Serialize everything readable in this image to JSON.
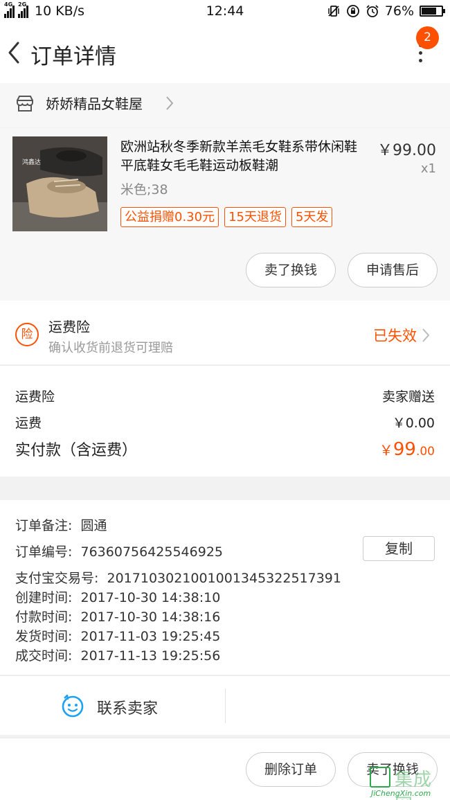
{
  "status_bar": {
    "network_4g": "4G",
    "network_2g": "2G",
    "speed": "10 KB/s",
    "time": "12:44",
    "battery_percent": "76%",
    "battery_level": 0.76
  },
  "header": {
    "title": "订单详情",
    "badge_count": "2"
  },
  "shop": {
    "name": "娇娇精品女鞋屋"
  },
  "product": {
    "title": "欧洲站秋冬季新款羊羔毛女鞋系带休闲鞋平底鞋女毛毛鞋运动板鞋潮",
    "price": "￥99.00",
    "quantity": "x1",
    "sku": "米色;38",
    "image_caption": "鸿鑫达",
    "tags": [
      "公益捐赠0.30元",
      "15天退货",
      "5天发"
    ],
    "actions": [
      "卖了换钱",
      "申请售后"
    ]
  },
  "insurance": {
    "title": "运费险",
    "icon_text": "险",
    "subtitle": "确认收货前退货可理赔",
    "status": "已失效"
  },
  "fees": {
    "insurance_label": "运费险",
    "insurance_value": "卖家赠送",
    "shipping_label": "运费",
    "shipping_value": "￥0.00",
    "total_label": "实付款（含运费）",
    "total_symbol": "￥",
    "total_int": "99",
    "total_dec": ".00"
  },
  "order_info": {
    "remark_label": "订单备注:",
    "remark_value": "圆通",
    "number_label": "订单编号:",
    "number_value": "76360756425546925",
    "copy_label": "复制",
    "alipay_label": "支付宝交易号:",
    "alipay_value": "2017103021001001345322517391",
    "created_label": "创建时间:",
    "created_value": "2017-10-30 14:38:10",
    "paid_label": "付款时间:",
    "paid_value": "2017-10-30 14:38:16",
    "shipped_label": "发货时间:",
    "shipped_value": "2017-11-03 19:25:45",
    "completed_label": "成交时间:",
    "completed_value": "2017-11-13 19:25:56"
  },
  "contact": {
    "label": "联系卖家"
  },
  "bottom_actions": {
    "delete_label": "删除订单",
    "sell_label": "卖了换钱"
  },
  "watermark": {
    "text": "集成网",
    "url": "JiChengXin.com"
  },
  "colors": {
    "accent": "#ff5000",
    "text": "#222222",
    "muted": "#999999"
  }
}
